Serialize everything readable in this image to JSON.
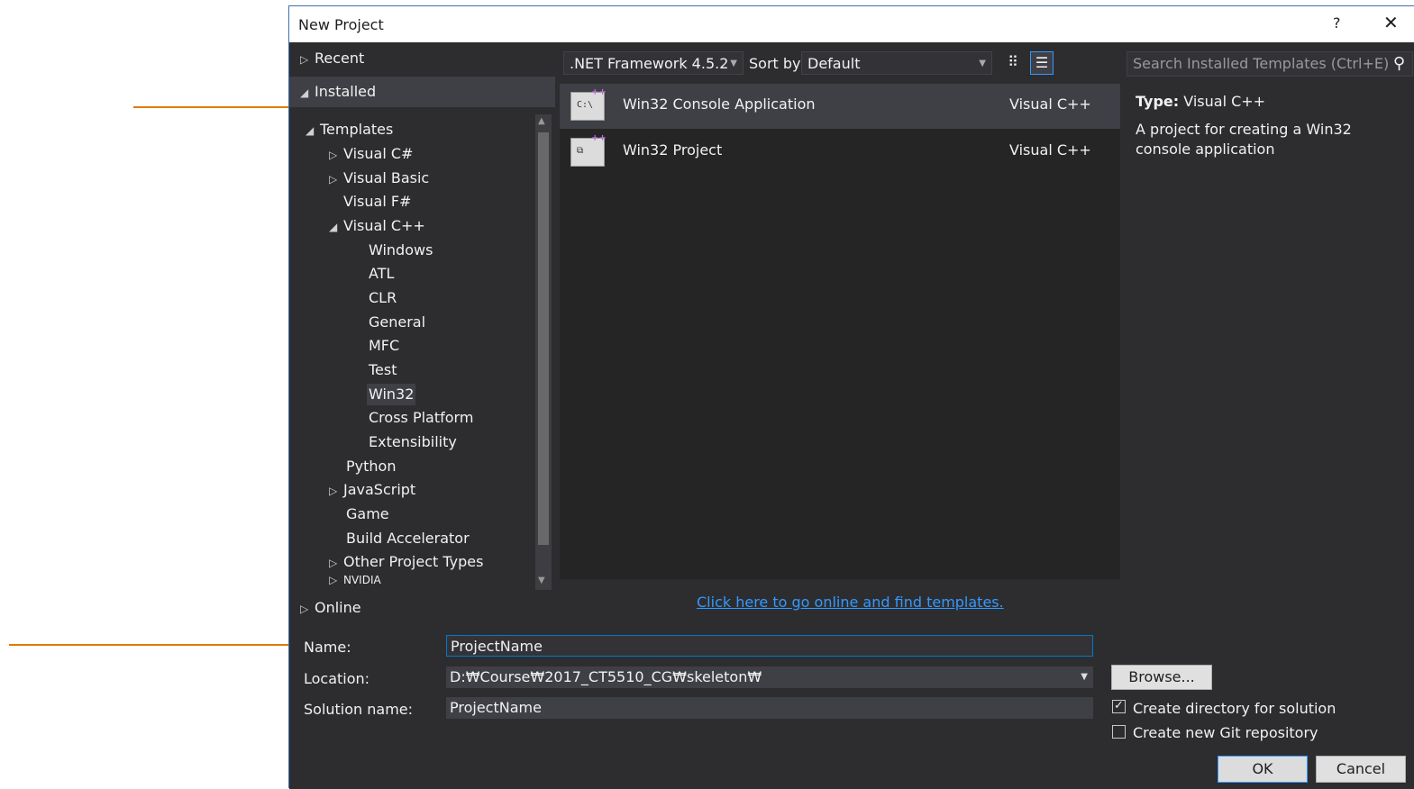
{
  "window": {
    "title": "New Project",
    "help": "?",
    "close": "✕"
  },
  "left_nav": {
    "recent": "Recent",
    "installed": "Installed",
    "templates": "Templates",
    "items": [
      {
        "label": "Visual C#"
      },
      {
        "label": "Visual Basic"
      },
      {
        "label": "Visual F#"
      },
      {
        "label": "Visual C++"
      },
      {
        "label": "Windows"
      },
      {
        "label": "ATL"
      },
      {
        "label": "CLR"
      },
      {
        "label": "General"
      },
      {
        "label": "MFC"
      },
      {
        "label": "Test"
      },
      {
        "label": "Win32"
      },
      {
        "label": "Cross Platform"
      },
      {
        "label": "Extensibility"
      },
      {
        "label": "Python"
      },
      {
        "label": "JavaScript"
      },
      {
        "label": "Game"
      },
      {
        "label": "Build Accelerator"
      },
      {
        "label": "Other Project Types"
      },
      {
        "label": "NVIDIA"
      }
    ],
    "online": "Online"
  },
  "toolbar": {
    "framework": ".NET Framework 4.5.2",
    "sort_label": "Sort by:",
    "sort_value": "Default"
  },
  "templates": [
    {
      "name": "Win32 Console Application",
      "lang": "Visual C++",
      "icon": "console-app-icon"
    },
    {
      "name": "Win32 Project",
      "lang": "Visual C++",
      "icon": "win32-project-icon"
    }
  ],
  "details": {
    "search_placeholder": "Search Installed Templates (Ctrl+E)",
    "type_label": "Type:",
    "type_value": "Visual C++",
    "description": "A project for creating a Win32 console application"
  },
  "online_link": "Click here to go online and find templates.",
  "form": {
    "name_label": "Name:",
    "name_value": "ProjectName",
    "location_label": "Location:",
    "location_value": "D:₩Course₩2017_CT5510_CG₩skeleton₩",
    "solution_label": "Solution name:",
    "solution_value": "ProjectName",
    "browse": "Browse...",
    "create_dir": "Create directory for solution",
    "create_dir_checked": true,
    "create_git": "Create new Git repository",
    "create_git_checked": false,
    "ok": "OK",
    "cancel": "Cancel"
  },
  "colors": {
    "accent": "#007acc",
    "annotation_arrow": "#e07b00",
    "link": "#3399ff"
  }
}
